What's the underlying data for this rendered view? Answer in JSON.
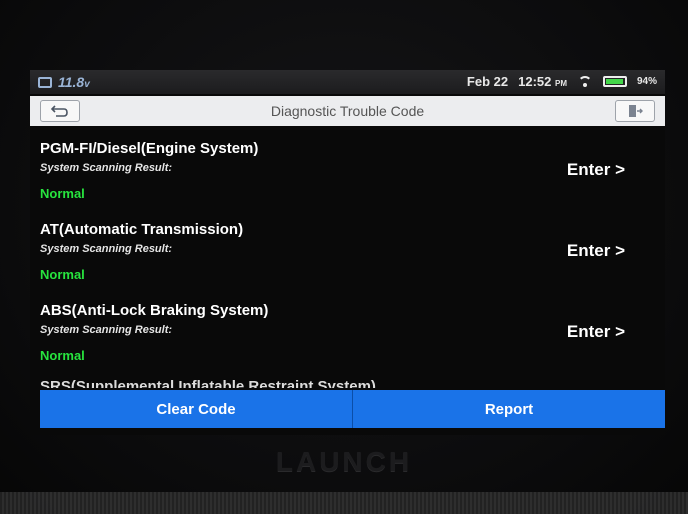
{
  "status_bar": {
    "voltage": "11.8",
    "voltage_unit": "v",
    "date": "Feb 22",
    "time": "12:52",
    "ampm": "PM",
    "battery_percent": "94%",
    "battery_level": 0.94,
    "icons": [
      "calendar-icon",
      "wifi-icon",
      "battery-icon"
    ]
  },
  "title_bar": {
    "title": "Diagnostic Trouble Code",
    "back_icon": "back-arrow-icon",
    "exit_icon": "exit-icon"
  },
  "systems": [
    {
      "name": "PGM-FI/Diesel(Engine System)",
      "result_label": "System Scanning Result:",
      "result": "Normal",
      "action": "Enter >"
    },
    {
      "name": "AT(Automatic Transmission)",
      "result_label": "System Scanning Result:",
      "result": "Normal",
      "action": "Enter >"
    },
    {
      "name": "ABS(Anti-Lock Braking System)",
      "result_label": "System Scanning Result:",
      "result": "Normal",
      "action": "Enter >"
    }
  ],
  "partial_item": {
    "name": "SRS(Supplemental Inflatable Restraint System)"
  },
  "buttons": {
    "clear_code": "Clear Code",
    "report": "Report"
  },
  "device": {
    "brand": "LAUNCH"
  },
  "colors": {
    "accent": "#1a73e8",
    "status_normal": "#27e33e",
    "title_bar_bg": "#ecedef"
  }
}
